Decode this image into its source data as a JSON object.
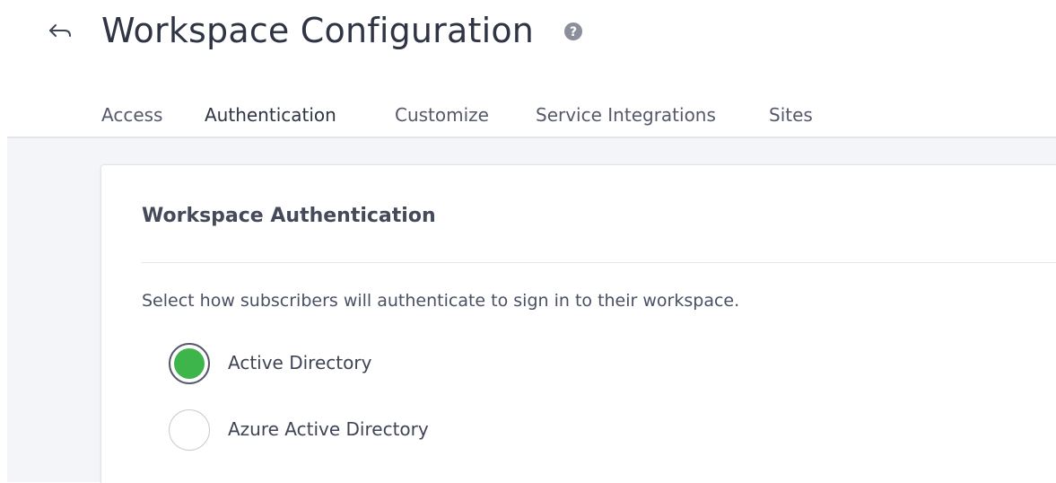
{
  "header": {
    "title": "Workspace Configuration",
    "back_icon": "back-arrow-icon",
    "help_icon": "help-icon"
  },
  "tabs": [
    {
      "label": "Access",
      "active": false
    },
    {
      "label": "Authentication",
      "active": true
    },
    {
      "label": "Customize",
      "active": false
    },
    {
      "label": "Service Integrations",
      "active": false
    },
    {
      "label": "Sites",
      "active": false
    }
  ],
  "card": {
    "title": "Workspace Authentication",
    "description": "Select how subscribers will authenticate to sign in to their workspace.",
    "options": [
      {
        "label": "Active Directory",
        "selected": true
      },
      {
        "label": "Azure Active Directory",
        "selected": false
      }
    ]
  },
  "colors": {
    "selected_radio": "#3db54a",
    "active_tab_underline": "#3b4158",
    "content_background": "#f3f5f8"
  }
}
